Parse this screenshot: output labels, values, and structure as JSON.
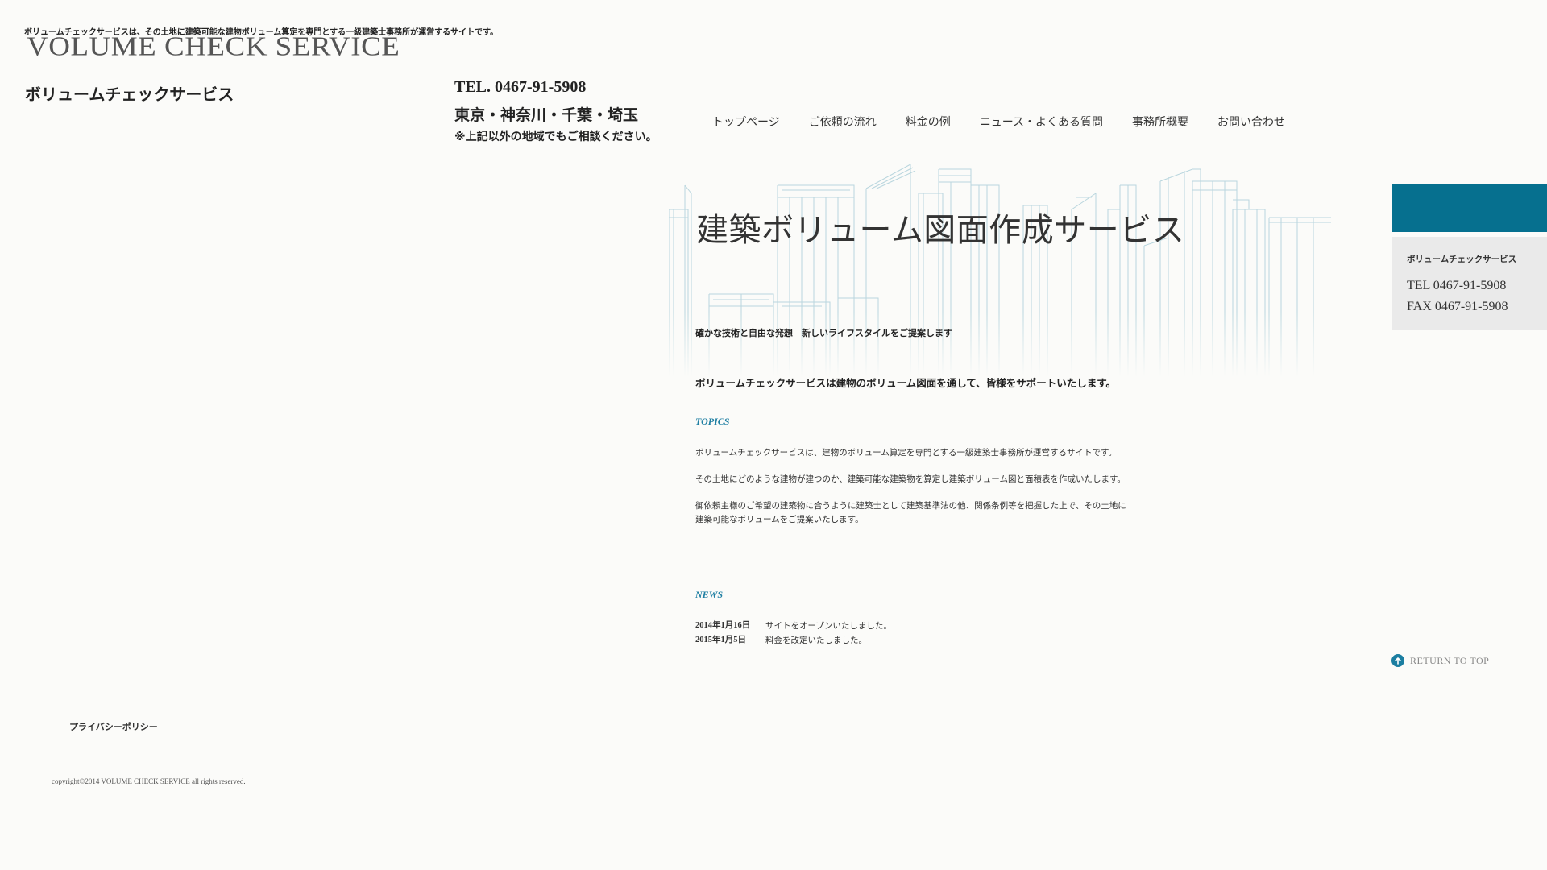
{
  "header": {
    "tagline": "ボリュームチェックサービスは、その土地に建築可能な建物ボリューム算定を専門とする一級建築士事務所が運営するサイトです。",
    "logo_text": "VOLUME CHECK SERVICE",
    "site_name": "ボリュームチェックサービス",
    "tel": "TEL. 0467-91-5908",
    "area": "東京・神奈川・千葉・埼玉",
    "area_note": "※上記以外の地域でもご相談ください。"
  },
  "nav": {
    "items": [
      {
        "label": "トップページ"
      },
      {
        "label": "ご依頼の流れ"
      },
      {
        "label": "料金の例"
      },
      {
        "label": "ニュース・よくある質問"
      },
      {
        "label": "事務所概要"
      },
      {
        "label": "お問い合わせ"
      }
    ]
  },
  "hero": {
    "title": "建築ボリューム図面作成サービス",
    "subtitle": "確かな技術と自由な発想　新しいライフスタイルをご提案します"
  },
  "main": {
    "intro": "ボリュームチェックサービスは建物のボリューム図面を通して、皆様をサポートいたします。",
    "topics_heading": "TOPICS",
    "topics_paragraphs": [
      "ボリュームチェックサービスは、建物のボリューム算定を専門とする一級建築士事務所が運営するサイトです。",
      "その土地にどのような建物が建つのか、建築可能な建築物を算定し建築ボリューム図と面積表を作成いたします。",
      "御依頼主様のご希望の建築物に合うように建築士として建築基準法の他、関係条例等を把握した上で、その土地に建築可能なボリュームをご提案いたします。"
    ],
    "news_heading": "NEWS",
    "news": [
      {
        "date": "2014年1月16日",
        "text": "サイトをオープンいたしました。"
      },
      {
        "date": "2015年1月5日",
        "text": "料金を改定いたしました。"
      }
    ]
  },
  "sidebar": {
    "name": "ボリュームチェックサービス",
    "tel": "TEL 0467-91-5908",
    "fax": "FAX 0467-91-5908",
    "accent_color": "#06708f"
  },
  "return_top": {
    "label": "RETURN TO TOP",
    "icon": "arrow-up-circle-icon"
  },
  "footer": {
    "privacy": "プライバシーポリシー",
    "copyright": "copyright©2014 VOLUME CHECK SERVICE all rights reserved."
  },
  "colors": {
    "background": "#fbfbf9",
    "accent": "#1f7fa3",
    "sidebar_box": "#eaeaea"
  }
}
